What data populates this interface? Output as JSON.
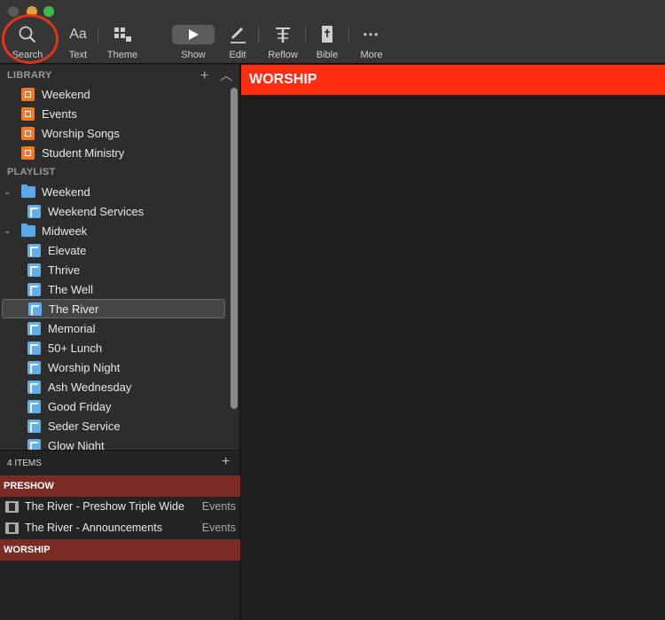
{
  "toolbar": {
    "search": "Search",
    "text": "Text",
    "text_glyph": "Aa",
    "theme": "Theme",
    "show": "Show",
    "edit": "Edit",
    "reflow": "Reflow",
    "bible": "Bible",
    "more": "More",
    "more_glyph": "•••"
  },
  "library": {
    "heading": "LIBRARY",
    "items": [
      "Weekend",
      "Events",
      "Worship Songs",
      "Student Ministry"
    ]
  },
  "playlist": {
    "heading": "PLAYLIST",
    "rows": [
      {
        "label": "Weekend"
      },
      {
        "label": "Weekend Services"
      },
      {
        "label": "Midweek"
      },
      {
        "label": "Elevate"
      },
      {
        "label": "Thrive"
      },
      {
        "label": "The Well"
      },
      {
        "label": "The River"
      },
      {
        "label": "Memorial"
      },
      {
        "label": "50+ Lunch"
      },
      {
        "label": "Worship Night"
      },
      {
        "label": "Ash Wednesday"
      },
      {
        "label": "Good Friday"
      },
      {
        "label": "Seder Service"
      },
      {
        "label": "Glow Night"
      }
    ]
  },
  "playlist_items": {
    "count": "4 ITEMS",
    "headers": [
      "PRESHOW",
      "WORSHIP"
    ],
    "rows": [
      {
        "title": "The River - Preshow Triple Wide",
        "library": "Events"
      },
      {
        "title": "The River - Announcements",
        "library": "Events"
      }
    ]
  },
  "main": {
    "header": "WORSHIP"
  },
  "colors": {
    "accent_header": "#ff2d12",
    "section_header": "#7a2b24",
    "library_icon": "#ee7a2a",
    "playlist_icon": "#62aee8",
    "highlight_ring": "#e2341d"
  }
}
